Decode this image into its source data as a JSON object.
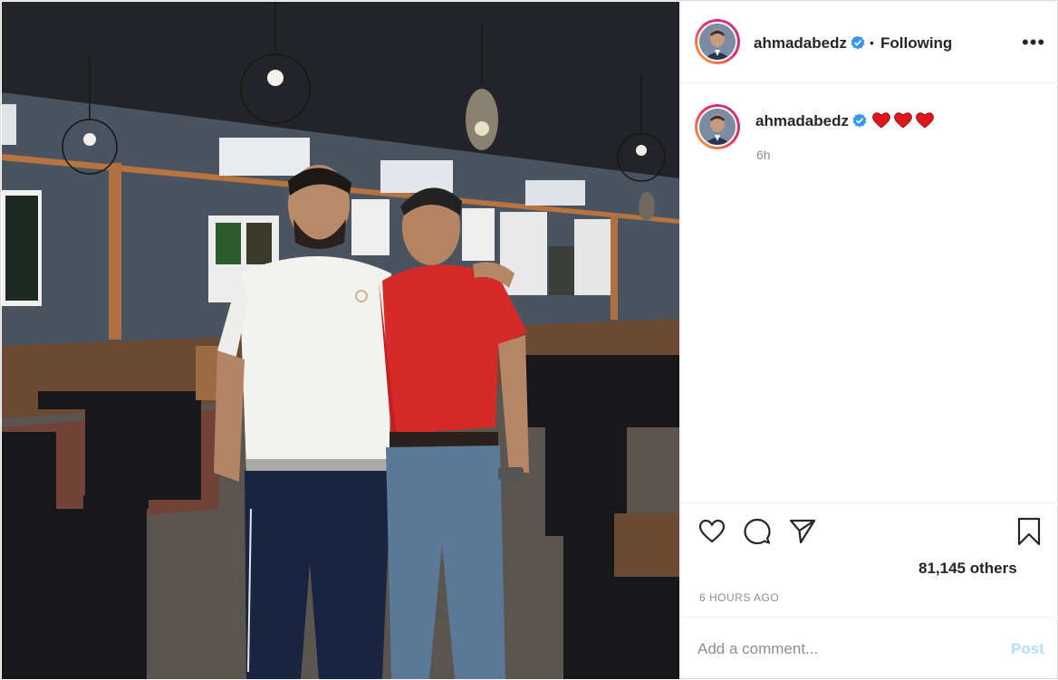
{
  "post": {
    "author": "ahmadabedz",
    "follow_separator": "•",
    "follow_status": "Following",
    "more_label": "•••",
    "caption_author": "ahmadabedz",
    "caption_emojis": "❤❤❤",
    "caption_time": "6h",
    "likes_text": "81,145 others",
    "posted_ago": "6 HOURS AGO"
  },
  "comment": {
    "placeholder": "Add a comment...",
    "post_label": "Post"
  },
  "colors": {
    "verified": "#3897f0",
    "heart_emoji": "#e0161d",
    "post_button": "#b2dffc",
    "shirt_red": "#d42a2a"
  },
  "icons": [
    "verified-badge-icon",
    "more-options-icon",
    "heart-icon",
    "comment-icon",
    "share-icon",
    "bookmark-icon"
  ]
}
